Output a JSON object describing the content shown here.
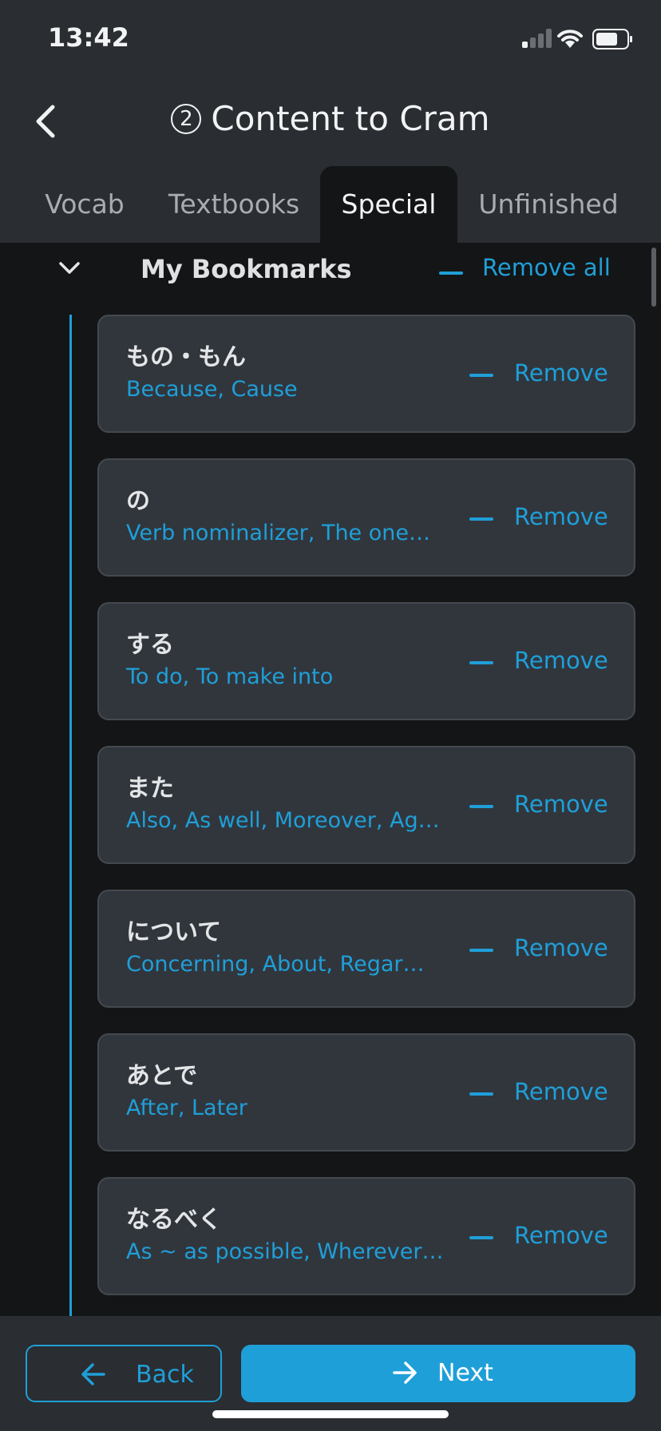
{
  "status": {
    "time": "13:42"
  },
  "header": {
    "title": "Content to Cram",
    "step": "②"
  },
  "tabs": [
    {
      "label": "Vocab",
      "active": false
    },
    {
      "label": "Textbooks",
      "active": false
    },
    {
      "label": "Special",
      "active": true
    },
    {
      "label": "Unfinished",
      "active": false
    }
  ],
  "section": {
    "title": "My Bookmarks",
    "remove_all_label": "Remove all"
  },
  "items": [
    {
      "term": "もの・もん",
      "meaning": "Because, Cause",
      "remove_label": "Remove"
    },
    {
      "term": "の",
      "meaning": "Verb nominalizer, The one…",
      "remove_label": "Remove"
    },
    {
      "term": "する",
      "meaning": "To do, To make into",
      "remove_label": "Remove"
    },
    {
      "term": "また",
      "meaning": "Also, As well, Moreover, Ag…",
      "remove_label": "Remove"
    },
    {
      "term": "について",
      "meaning": "Concerning, About, Regar…",
      "remove_label": "Remove"
    },
    {
      "term": "あとで",
      "meaning": "After, Later",
      "remove_label": "Remove"
    },
    {
      "term": "なるべく",
      "meaning": "As ~ as possible, Wherever…",
      "remove_label": "Remove"
    }
  ],
  "footer": {
    "back_label": "Back",
    "next_label": "Next"
  },
  "colors": {
    "accent": "#1f9fd8",
    "header_bg": "#2a2d31",
    "page_bg": "#141516",
    "card_bg": "#31363d"
  },
  "icons": {
    "back": "chevron-left-icon",
    "collapse": "chevron-down-icon",
    "remove": "minus-icon",
    "back_button": "arrow-left-icon",
    "next_button": "arrow-right-icon"
  }
}
